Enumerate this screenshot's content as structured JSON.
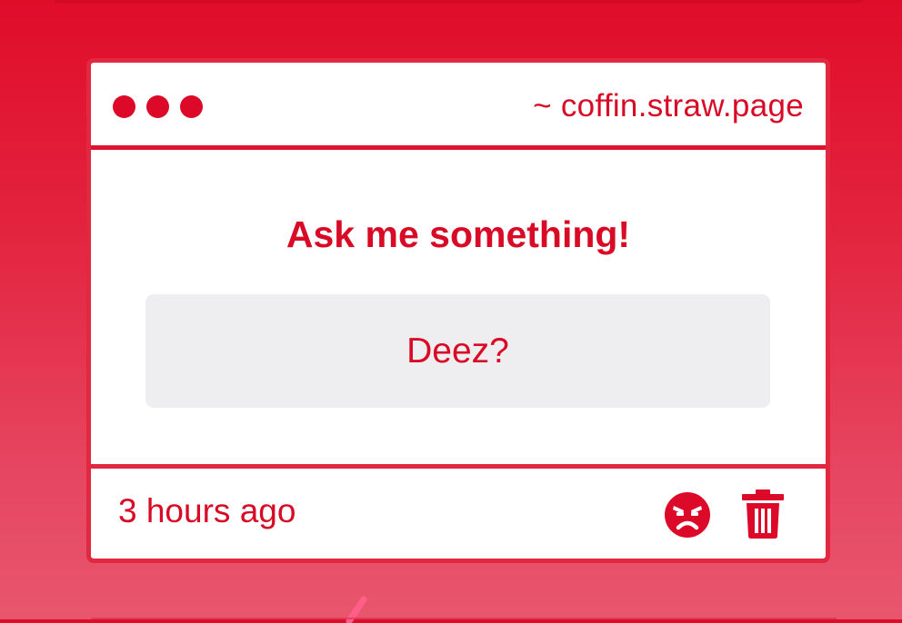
{
  "window": {
    "url": "~ coffin.straw.page"
  },
  "main": {
    "prompt": "Ask me something!",
    "question": "Deez?"
  },
  "footer": {
    "timestamp": "3 hours ago",
    "actions": {
      "react_icon": "angry-face-icon",
      "delete_icon": "trash-icon"
    }
  },
  "colors": {
    "accent": "#dc0a28",
    "card_border": "#e22840",
    "question_bg": "#eeedef",
    "background_top": "#e00d29",
    "background_bottom": "#e8566e"
  }
}
